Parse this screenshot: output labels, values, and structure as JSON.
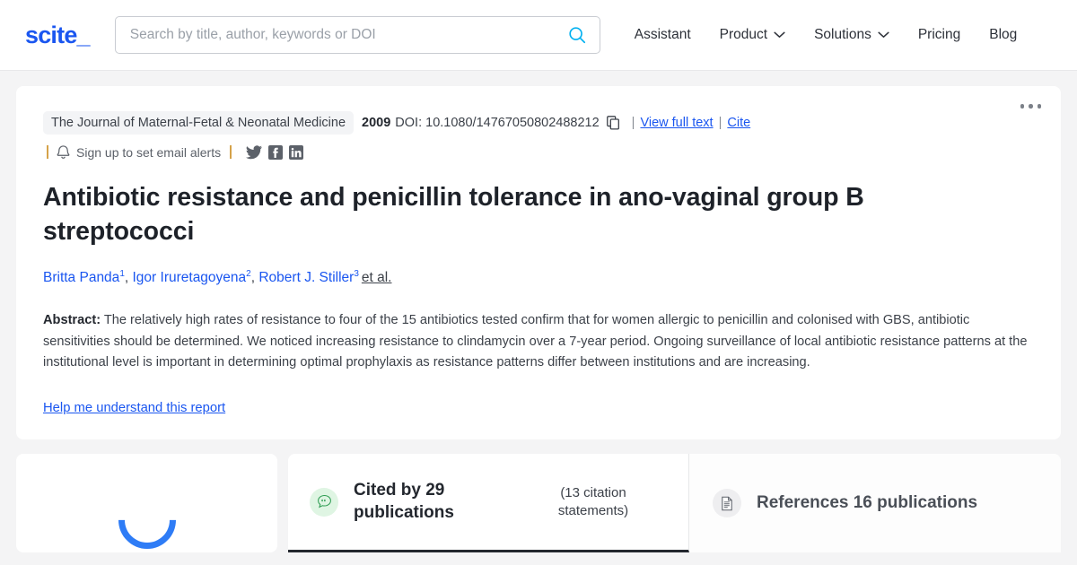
{
  "brand": {
    "logo_text": "scite_",
    "accent_blue": "#1a56f0",
    "search_icon_color": "#00b0f0",
    "page_bg": "#f4f4f5"
  },
  "header": {
    "search": {
      "placeholder": "Search by title, author, keywords or DOI",
      "value": "",
      "icon": "search-icon"
    },
    "nav": [
      {
        "label": "Assistant",
        "has_caret": false
      },
      {
        "label": "Product",
        "has_caret": true
      },
      {
        "label": "Solutions",
        "has_caret": true
      },
      {
        "label": "Pricing",
        "has_caret": false
      },
      {
        "label": "Blog",
        "has_caret": false
      }
    ]
  },
  "publication": {
    "journal": "The Journal of Maternal-Fetal & Neonatal Medicine",
    "year": "2009",
    "doi_label": "DOI: 10.1080/14767050802488212",
    "copy_icon": "copy-icon",
    "separator": "|",
    "view_full_text": "View full text",
    "cite": "Cite",
    "alerts": {
      "bell_icon": "bell-icon",
      "label": "Sign up to set email alerts",
      "social": [
        {
          "name": "twitter-icon",
          "label": "Twitter"
        },
        {
          "name": "facebook-icon",
          "label": "Facebook"
        },
        {
          "name": "linkedin-icon",
          "label": "LinkedIn"
        }
      ]
    },
    "title": "Antibiotic resistance and penicillin tolerance in ano-vaginal group B streptococci",
    "authors": [
      {
        "name": "Britta Panda",
        "affiliation": "1"
      },
      {
        "name": "Igor Iruretagoyena",
        "affiliation": "2"
      },
      {
        "name": "Robert J. Stiller",
        "affiliation": "3"
      }
    ],
    "et_al": "et al.",
    "abstract_label": "Abstract:",
    "abstract_body": "The relatively high rates of resistance to four of the 15 antibiotics tested confirm that for women allergic to penicillin and colonised with GBS, antibiotic sensitivities should be determined. We noticed increasing resistance to clindamycin over a 7-year period. Ongoing surveillance of local antibiotic resistance patterns at the institutional level is important in determining optimal prophylaxis as resistance patterns differ between institutions and are increasing.",
    "help_link": "Help me understand this report",
    "overflow_menu": "more-options"
  },
  "loading": {
    "spinner": "loading-spinner"
  },
  "tabs": [
    {
      "id": "cited-by",
      "icon": "citation-bubble-icon",
      "label": "Cited by 29 publications",
      "sub_label": "(13 citation statements)",
      "active": true
    },
    {
      "id": "references",
      "icon": "document-icon",
      "label": "References 16 publications",
      "sub_label": "",
      "active": false
    }
  ]
}
